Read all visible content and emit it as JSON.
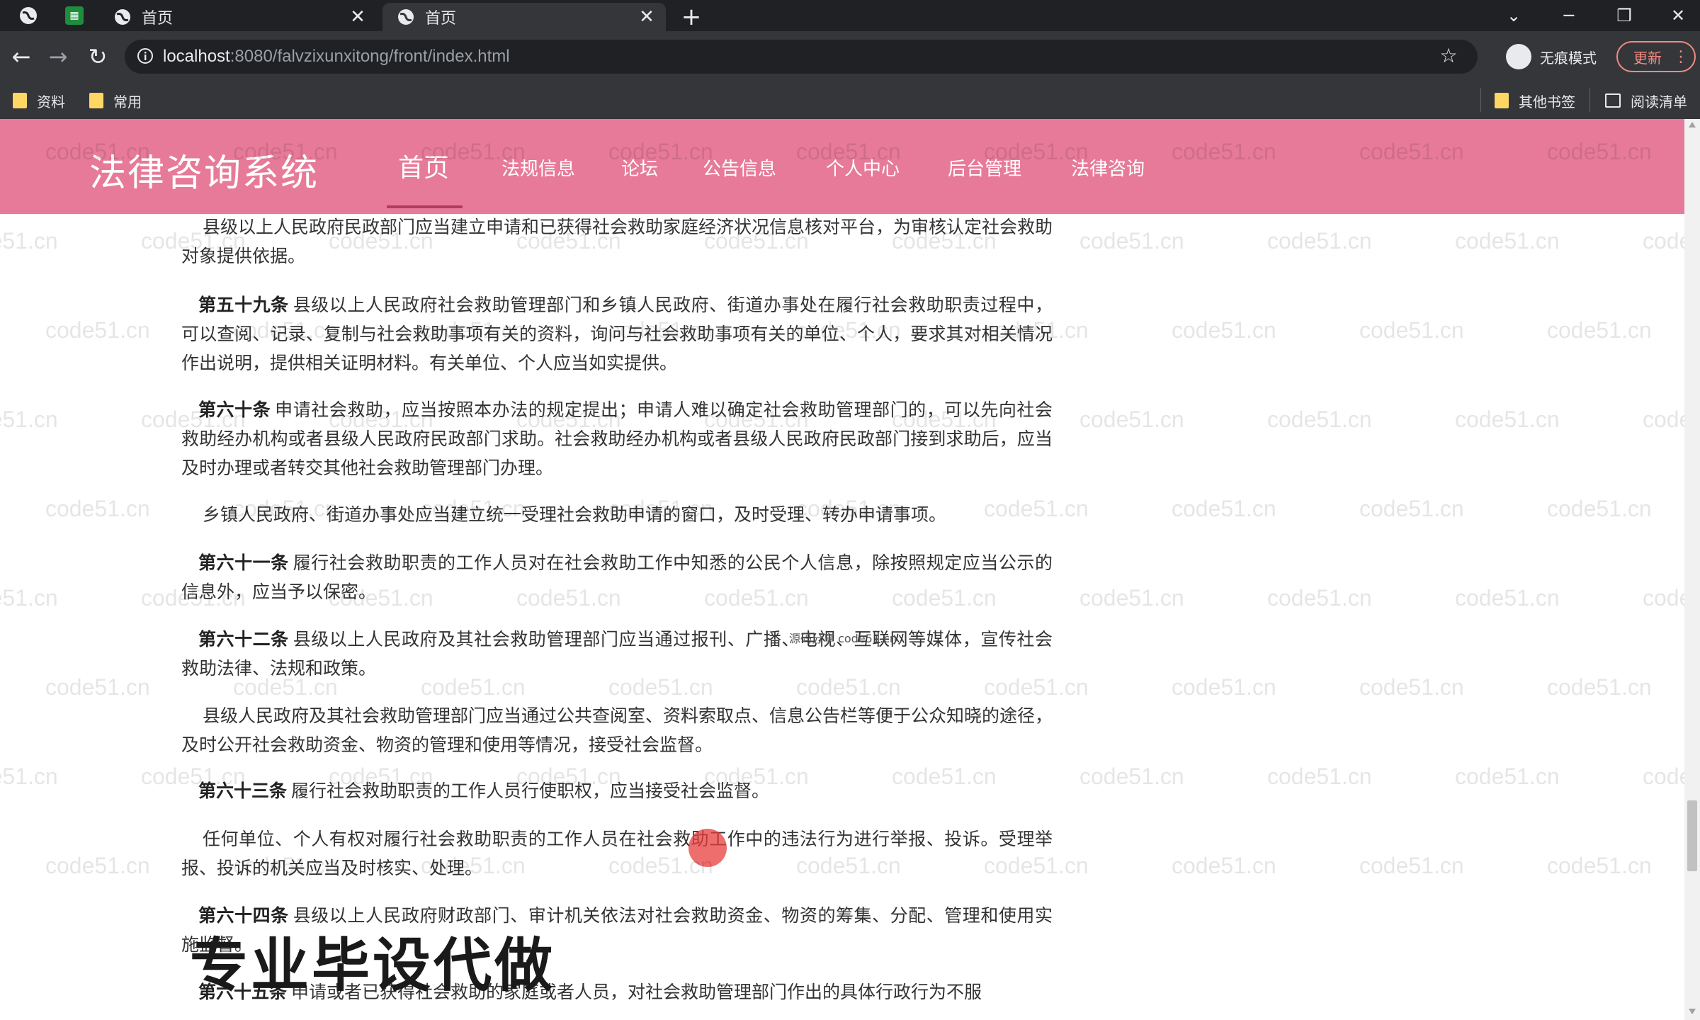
{
  "browser": {
    "tabs": [
      {
        "title": "首页"
      },
      {
        "title": "首页"
      }
    ],
    "url_host": "localhost",
    "url_path": ":8080/falvzixunxitong/front/index.html",
    "incognito_label": "无痕模式",
    "update_label": "更新",
    "bookmarks": [
      {
        "label": "资料"
      },
      {
        "label": "常用"
      }
    ],
    "other_bookmarks_label": "其他书签",
    "reading_list_label": "阅读清单"
  },
  "site": {
    "title": "法律咨询系统",
    "nav": [
      {
        "label": "首页",
        "active": true
      },
      {
        "label": "法规信息"
      },
      {
        "label": "论坛"
      },
      {
        "label": "公告信息"
      },
      {
        "label": "个人中心"
      },
      {
        "label": "后台管理"
      },
      {
        "label": "法律咨询"
      }
    ]
  },
  "article": {
    "paragraphs": [
      {
        "number": "",
        "text": "县级以上人民政府民政部门应当建立申请和已获得社会救助家庭经济状况信息核对平台，为审核认定社会救助对象提供依据。"
      },
      {
        "number": "第五十九条",
        "text": "县级以上人民政府社会救助管理部门和乡镇人民政府、街道办事处在履行社会救助职责过程中，可以查阅、记录、复制与社会救助事项有关的资料，询问与社会救助事项有关的单位、个人，要求其对相关情况作出说明，提供相关证明材料。有关单位、个人应当如实提供。"
      },
      {
        "number": "第六十条",
        "text": "申请社会救助，应当按照本办法的规定提出；申请人难以确定社会救助管理部门的，可以先向社会救助经办机构或者县级人民政府民政部门求助。社会救助经办机构或者县级人民政府民政部门接到求助后，应当及时办理或者转交其他社会救助管理部门办理。"
      },
      {
        "number": "",
        "text": "乡镇人民政府、街道办事处应当建立统一受理社会救助申请的窗口，及时受理、转办申请事项。"
      },
      {
        "number": "第六十一条",
        "text": "履行社会救助职责的工作人员对在社会救助工作中知悉的公民个人信息，除按照规定应当公示的信息外，应当予以保密。"
      },
      {
        "number": "第六十二条",
        "text": "县级以上人民政府及其社会救助管理部门应当通过报刊、广播、电视、互联网等媒体，宣传社会救助法律、法规和政策。"
      },
      {
        "number": "",
        "text": "县级人民政府及其社会救助管理部门应当通过公共查阅室、资料索取点、信息公告栏等便于公众知晓的途径，及时公开社会救助资金、物资的管理和使用等情况，接受社会监督。"
      },
      {
        "number": "第六十三条",
        "text": "履行社会救助职责的工作人员行使职权，应当接受社会监督。"
      },
      {
        "number": "",
        "text": "任何单位、个人有权对履行社会救助职责的工作人员在社会救助工作中的违法行为进行举报、投诉。受理举报、投诉的机关应当及时核实、处理。"
      },
      {
        "number": "第六十四条",
        "text": "县级以上人民政府财政部门、审计机关依法对社会救助资金、物资的筹集、分配、管理和使用实施监督。"
      },
      {
        "number": "第六十五条",
        "text": "申请或者已获得社会救助的家庭或者人员，对社会救助管理部门作出的具体行政行为不服"
      }
    ]
  },
  "overlay": {
    "promo_text": "专业毕设代做",
    "tooltip_text": "源码分享 code51.cn",
    "watermark_text": "code51.cn"
  },
  "colors": {
    "header_bg": "#e77a99",
    "nav_underline": "#b23c60",
    "chrome_dark": "#202124",
    "chrome_mid": "#35363a"
  }
}
